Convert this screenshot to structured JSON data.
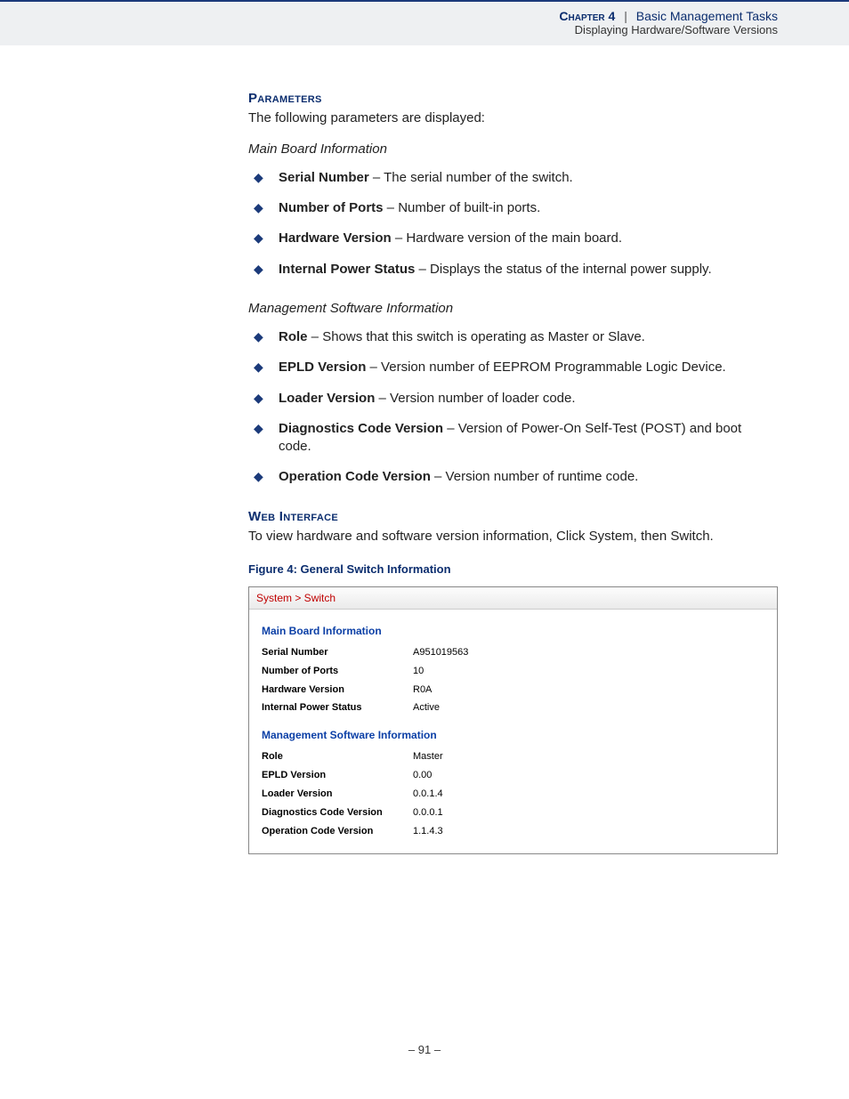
{
  "header": {
    "chapter": "Chapter 4",
    "sep": "|",
    "title": "Basic Management Tasks",
    "subtitle": "Displaying Hardware/Software Versions"
  },
  "sections": {
    "parameters": {
      "heading": "Parameters",
      "intro": "The following parameters are displayed:",
      "groups": [
        {
          "title": "Main Board Information",
          "items": [
            {
              "term": "Serial Number",
              "desc": " – The serial number of the switch."
            },
            {
              "term": "Number of Ports",
              "desc": " – Number of built-in ports."
            },
            {
              "term": "Hardware Version",
              "desc": " – Hardware version of the main board."
            },
            {
              "term": "Internal Power Status",
              "desc": " – Displays the status of the internal power supply."
            }
          ]
        },
        {
          "title": "Management Software Information",
          "items": [
            {
              "term": "Role",
              "desc": " – Shows that this switch is operating as Master or Slave."
            },
            {
              "term": "EPLD Version",
              "desc": " – Version number of EEPROM Programmable Logic Device."
            },
            {
              "term": "Loader Version",
              "desc": " – Version number of loader code."
            },
            {
              "term": "Diagnostics Code Version",
              "desc": " – Version of Power-On Self-Test (POST) and boot code."
            },
            {
              "term": "Operation Code Version",
              "desc": " – Version number of runtime code."
            }
          ]
        }
      ]
    },
    "web": {
      "heading": "Web Interface",
      "text": "To view hardware and software version information, Click System, then Switch."
    }
  },
  "figure": {
    "caption": "Figure 4:  General Switch Information",
    "breadcrumb": "System > Switch",
    "sections": [
      {
        "title": "Main Board Information",
        "rows": [
          {
            "k": "Serial Number",
            "v": "A951019563"
          },
          {
            "k": "Number of Ports",
            "v": "10"
          },
          {
            "k": "Hardware Version",
            "v": "R0A"
          },
          {
            "k": "Internal Power Status",
            "v": "Active"
          }
        ]
      },
      {
        "title": "Management Software Information",
        "rows": [
          {
            "k": "Role",
            "v": "Master"
          },
          {
            "k": "EPLD Version",
            "v": "0.00"
          },
          {
            "k": "Loader Version",
            "v": "0.0.1.4"
          },
          {
            "k": "Diagnostics Code Version",
            "v": "0.0.0.1"
          },
          {
            "k": "Operation Code Version",
            "v": "1.1.4.3"
          }
        ]
      }
    ]
  },
  "page_number": "– 91 –"
}
